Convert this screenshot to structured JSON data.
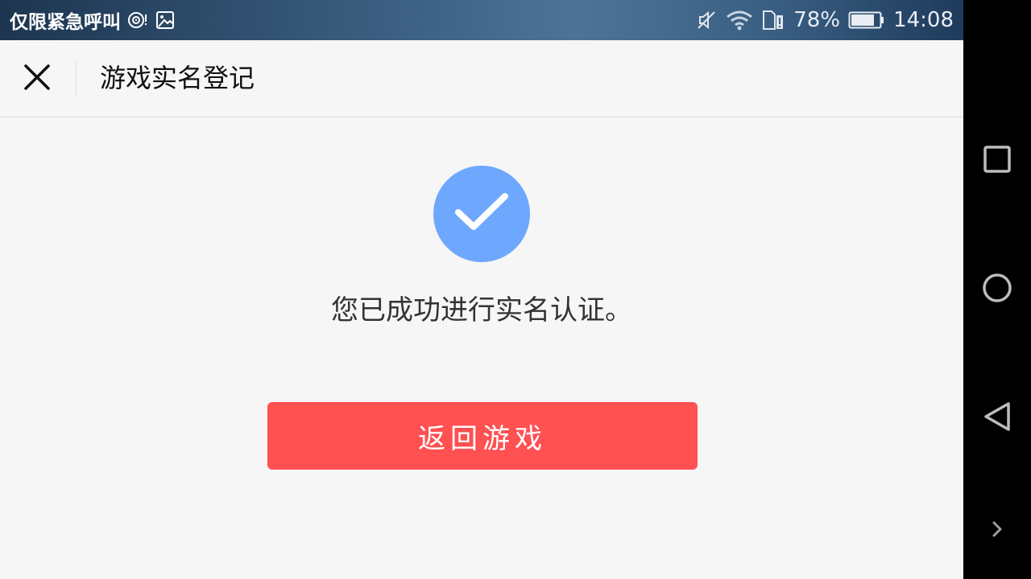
{
  "status_bar": {
    "carrier": "仅限紧急呼叫",
    "battery": "78%",
    "time": "14:08",
    "icons": [
      "hotspot-icon",
      "image-notification-icon",
      "mute-icon",
      "wifi-icon",
      "sim-alert-icon",
      "battery-icon"
    ]
  },
  "header": {
    "title": "游戏实名登记",
    "close_icon": "close-icon"
  },
  "main": {
    "success_icon": "checkmark-icon",
    "message": "您已成功进行实名认证。",
    "button_label": "返回游戏"
  },
  "nav_bar": {
    "icons": [
      "recents-icon",
      "home-icon",
      "back-icon",
      "expand-icon"
    ]
  },
  "colors": {
    "accent_blue": "#6ea8fe",
    "button_red": "#ff5052",
    "background": "#f6f6f6"
  }
}
